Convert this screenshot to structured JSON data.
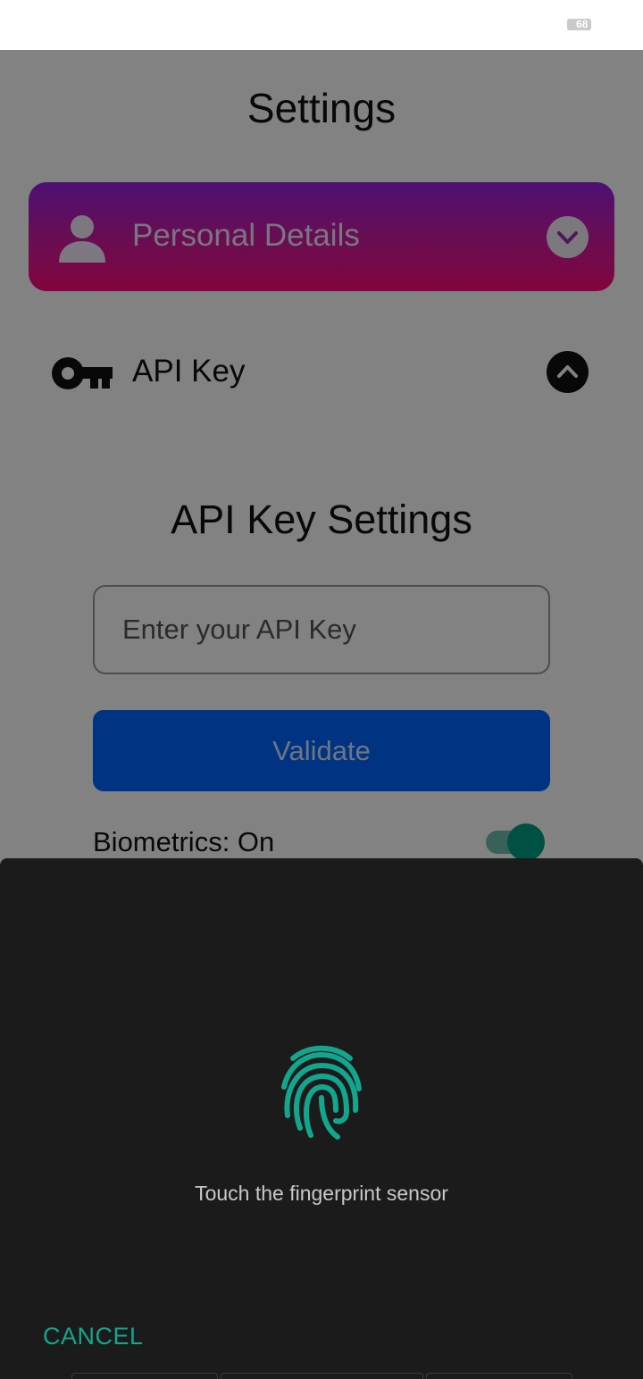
{
  "status_bar": {
    "battery_level": "68"
  },
  "settings": {
    "title": "Settings",
    "personal_details": {
      "label": "Personal Details",
      "icon": "person-icon",
      "toggle_icon": "chevron-down-icon"
    },
    "api_key_section": {
      "label": "API Key",
      "icon": "key-icon",
      "toggle_icon": "chevron-up-icon",
      "heading": "API Key Settings",
      "input_placeholder": "Enter your API Key",
      "input_value": "",
      "validate_label": "Validate",
      "biometrics_label": "Biometrics: On",
      "biometrics_enabled": true
    }
  },
  "biometric_prompt": {
    "icon": "fingerprint-icon",
    "message": "Touch the fingerprint sensor",
    "cancel_label": "CANCEL"
  },
  "colors": {
    "accent_teal": "#14a58e",
    "primary_blue": "#0066ff",
    "gradient_top": "#9a22e0",
    "gradient_bottom": "#ff0a7a"
  }
}
